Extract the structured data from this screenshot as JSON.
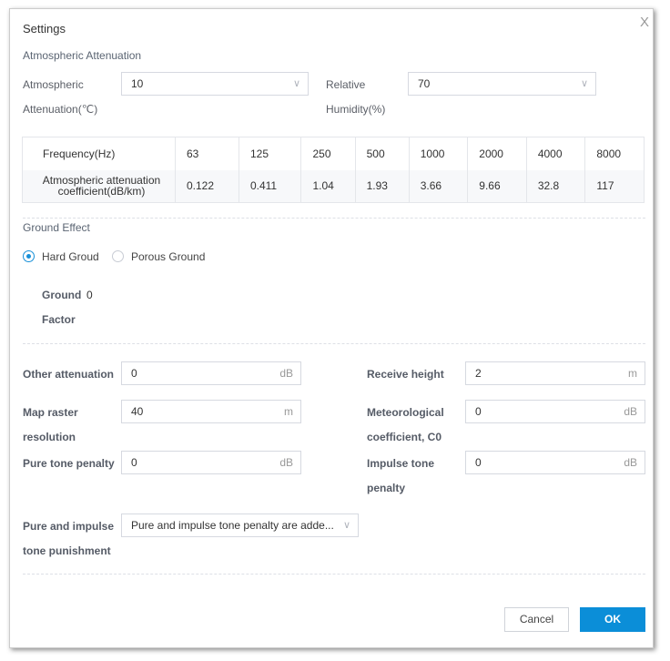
{
  "dialog": {
    "title": "Settings",
    "close": "X"
  },
  "atmos": {
    "section": "Atmospheric Attenuation",
    "temp_label_1": "Atmospheric",
    "temp_label_2": "Attenuation(℃)",
    "temp_value": "10",
    "hum_label_1": "Relative",
    "hum_label_2": "Humidity(%)",
    "hum_value": "70"
  },
  "table": {
    "row1_header": "Frequency(Hz)",
    "frequencies": [
      "63",
      "125",
      "250",
      "500",
      "1000",
      "2000",
      "4000",
      "8000"
    ],
    "row2_header": "Atmospheric attenuation coefficient(dB/km)",
    "coefficients": [
      "0.122",
      "0.411",
      "1.04",
      "1.93",
      "3.66",
      "9.66",
      "32.8",
      "117"
    ]
  },
  "ground": {
    "section": "Ground Effect",
    "option_hard": "Hard Groud",
    "option_porous": "Porous Ground",
    "selected": "Hard Groud",
    "factor_label_1": "Ground",
    "factor_label_2": "Factor",
    "factor_value": "0"
  },
  "fields": {
    "other_att": {
      "label": "Other attenuation",
      "value": "0",
      "unit": "dB"
    },
    "receive_height": {
      "label": "Receive height",
      "value": "2",
      "unit": "m"
    },
    "map_raster": {
      "label_1": "Map raster",
      "label_2": "resolution",
      "value": "40",
      "unit": "m"
    },
    "meteo": {
      "label_1": "Meteorological",
      "label_2": "coefficient, C0",
      "value": "0",
      "unit": "dB"
    },
    "pure_tone": {
      "label": "Pure tone penalty",
      "value": "0",
      "unit": "dB"
    },
    "impulse_tone": {
      "label_1": "Impulse tone",
      "label_2": "penalty",
      "value": "0",
      "unit": "dB"
    },
    "punishment": {
      "label_1": "Pure and impulse",
      "label_2": "tone punishment",
      "value": "Pure and impulse tone penalty are adde..."
    }
  },
  "buttons": {
    "cancel": "Cancel",
    "ok": "OK"
  },
  "colors": {
    "primary": "#0b8ed8"
  }
}
